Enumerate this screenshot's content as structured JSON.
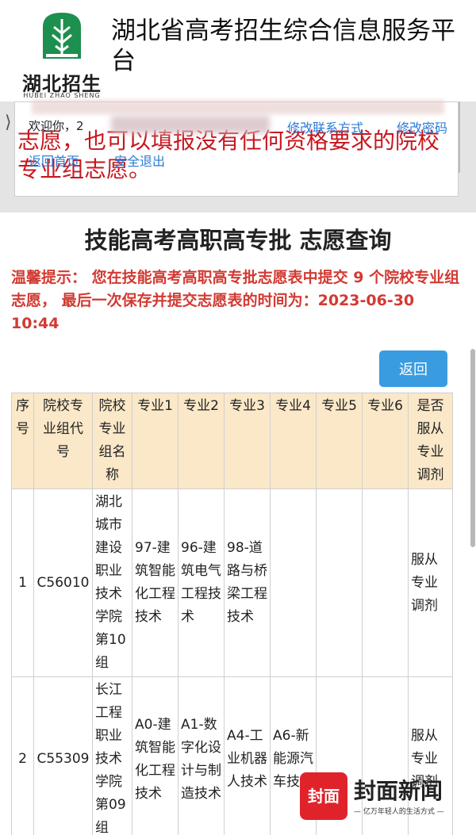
{
  "logo": {
    "name": "湖北招生",
    "pinyin": "HUBEI ZHAO SHENG"
  },
  "site_title": "湖北省高考招生综合信息服务平台",
  "notice": "志愿，也可以填报没有任何资格要求的院校专业组志愿。",
  "user_bar": {
    "welcome": "欢迎你，2",
    "edit_contact": "修改联系方式",
    "edit_password": "修改密码",
    "home": "返回首页",
    "logout": "安全退出"
  },
  "page_title": "技能高考高职高专批 志愿查询",
  "tip": "温馨提示： 您在技能高考高职高专批志愿表中提交 9 个院校专业组志愿， 最后一次保存并提交志愿表的时间为：2023-06-30 10:44",
  "back_button": "返回",
  "table": {
    "headers": [
      "序号",
      "院校专业组代号",
      "院校专业组名称",
      "专业1",
      "专业2",
      "专业3",
      "专业4",
      "专业5",
      "专业6",
      "是否服从专业调剂"
    ],
    "rows": [
      [
        "1",
        "C56010",
        "湖北城市建设职业技术学院第10组",
        "97-建筑智能化工程技术",
        "96-建筑电气工程技术",
        "98-道路与桥梁工程技术",
        "",
        "",
        "",
        "服从专业调剂"
      ],
      [
        "2",
        "C55309",
        "长江工程职业技术学院第09组",
        "A0-建筑智能化工程技术",
        "A1-数字化设计与制造技术",
        "A4-工业机器人技术",
        "A6-新能源汽车技术",
        "",
        "",
        "服从专业调剂"
      ]
    ]
  },
  "watermark": {
    "badge": "封面",
    "name": "封面新闻",
    "slogan": "— 亿万年轻人的生活方式 —"
  }
}
